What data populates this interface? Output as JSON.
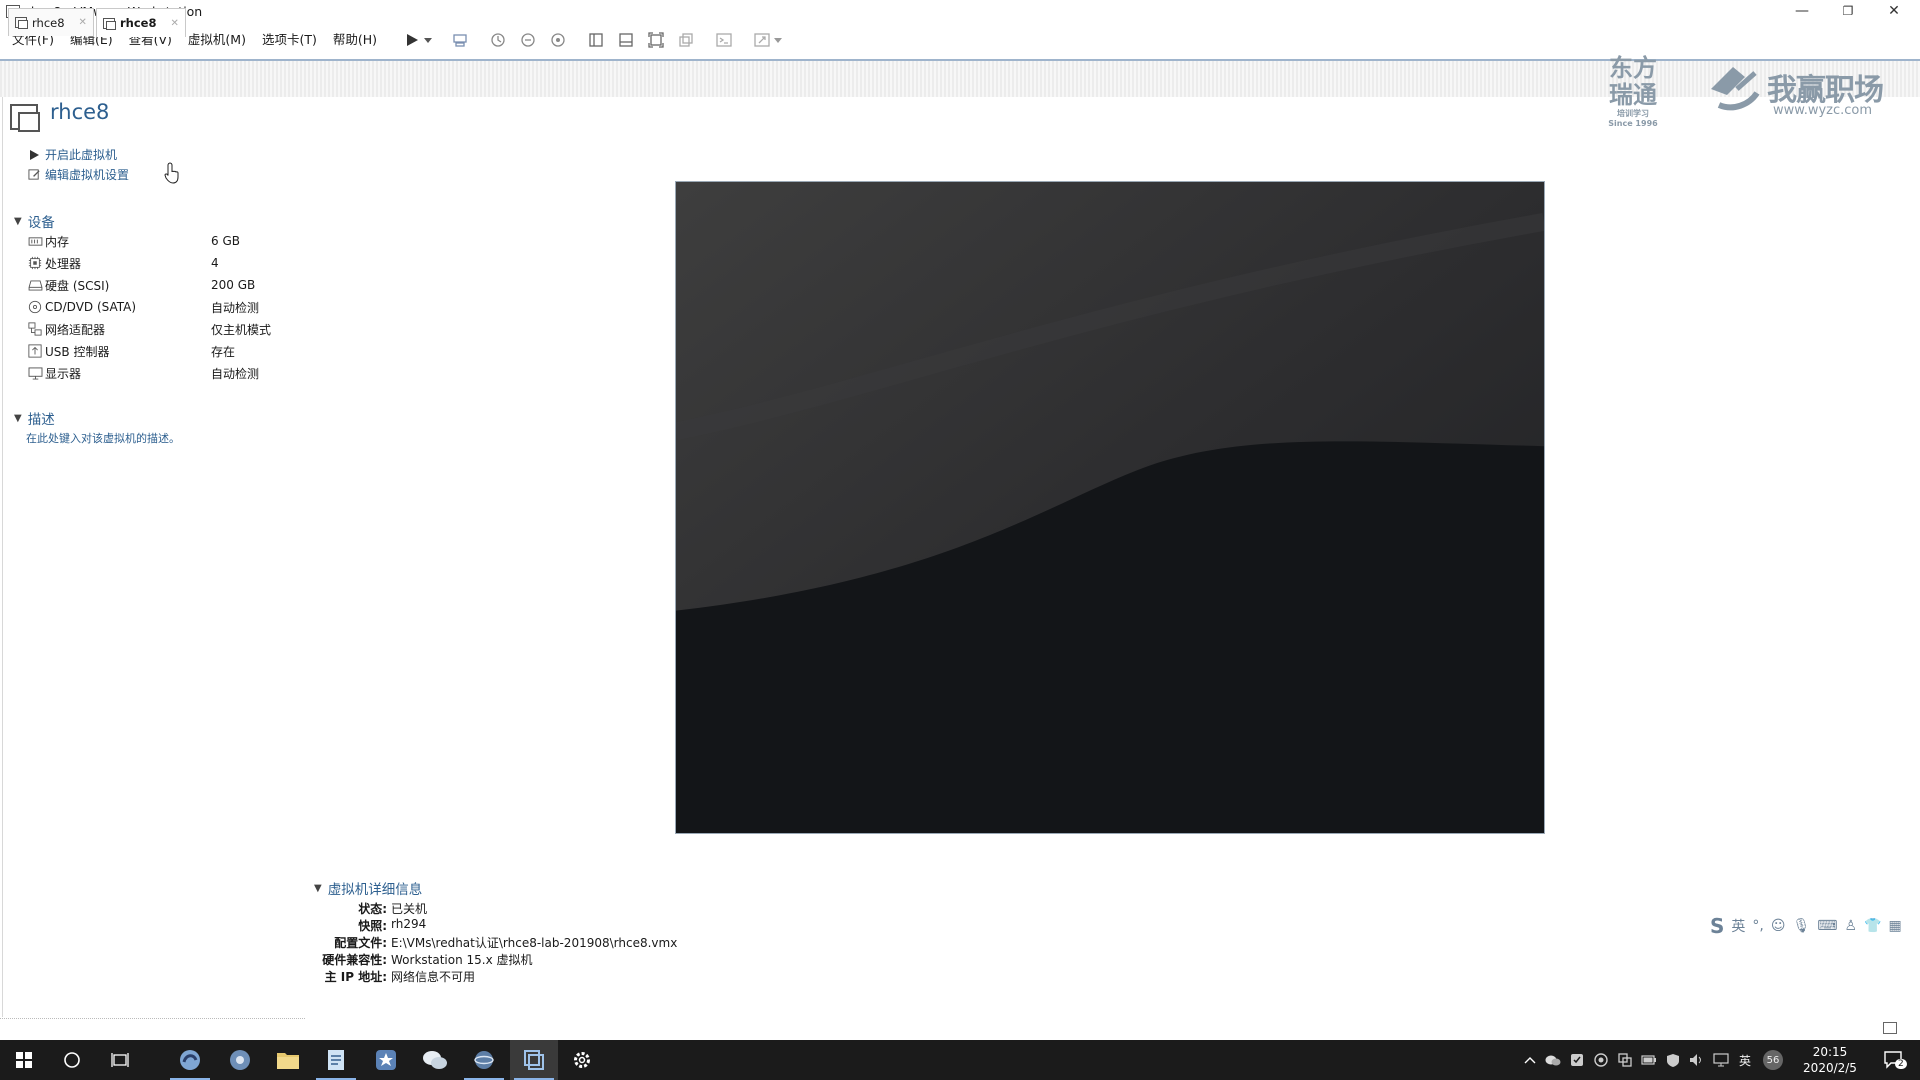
{
  "window": {
    "title": "rhce8 - VMware Workstation",
    "controls": [
      "—",
      "❐",
      "✕"
    ]
  },
  "menu": [
    "文件(F)",
    "编辑(E)",
    "查看(V)",
    "虚拟机(M)",
    "选项卡(T)",
    "帮助(H)"
  ],
  "tabs": [
    {
      "label": "rhce8",
      "active": false
    },
    {
      "label": "rhce8",
      "active": true
    }
  ],
  "watermark": {
    "brand1_line1": "东方",
    "brand1_line2": "瑞通",
    "brand1_sub": "培训学习",
    "brand1_since": "Since 1996",
    "brand2_name": "我赢职场",
    "brand2_url": "www.wyzc.com"
  },
  "vm": {
    "name": "rhce8",
    "actions": {
      "power_on": "开启此虚拟机",
      "edit_settings": "编辑虚拟机设置"
    }
  },
  "devices": {
    "section_title": "设备",
    "items": [
      {
        "icon": "memory-icon",
        "name": "内存",
        "value": "6 GB"
      },
      {
        "icon": "processor-icon",
        "name": "处理器",
        "value": "4"
      },
      {
        "icon": "hard-disk-icon",
        "name": "硬盘 (SCSI)",
        "value": "200 GB"
      },
      {
        "icon": "cd-dvd-icon",
        "name": "CD/DVD (SATA)",
        "value": "自动检测"
      },
      {
        "icon": "network-adapter-icon",
        "name": "网络适配器",
        "value": "仅主机模式"
      },
      {
        "icon": "usb-controller-icon",
        "name": "USB 控制器",
        "value": "存在"
      },
      {
        "icon": "display-icon",
        "name": "显示器",
        "value": "自动检测"
      }
    ]
  },
  "description": {
    "section_title": "描述",
    "placeholder": "在此处键入对该虚拟机的描述。"
  },
  "details": {
    "section_title": "虚拟机详细信息",
    "rows": [
      {
        "key": "状态:",
        "value": "已关机"
      },
      {
        "key": "快照:",
        "value": "rh294"
      },
      {
        "key": "配置文件:",
        "value": "E:\\VMs\\redhat认证\\rhce8-lab-201908\\rhce8.vmx"
      },
      {
        "key": "硬件兼容性:",
        "value": "Workstation 15.x 虚拟机"
      },
      {
        "key": "主 IP 地址:",
        "value": "网络信息不可用"
      }
    ]
  },
  "ime": {
    "label": "英"
  },
  "taskbar": {
    "tray_lang": "英",
    "tray_badge": "56",
    "time": "20:15",
    "date": "2020/2/5",
    "notif_count": "2"
  },
  "colors": {
    "accent": "#2d5f8f",
    "taskbar": "#1b1b1b",
    "preview_dark": "#121417"
  }
}
